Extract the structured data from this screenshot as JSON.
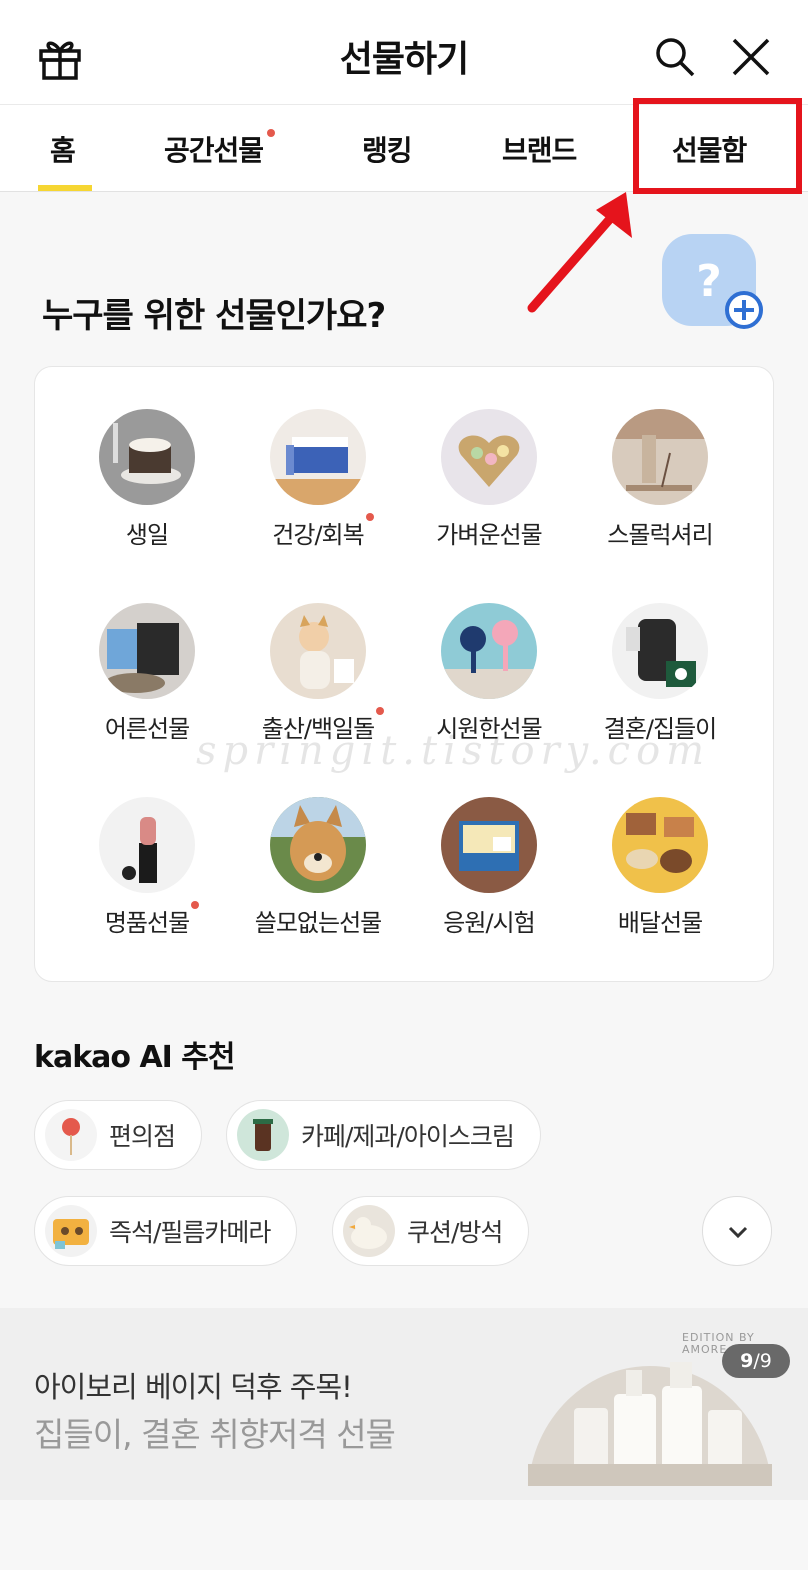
{
  "header": {
    "title": "선물하기"
  },
  "tabs": [
    {
      "label": "홈"
    },
    {
      "label": "공간선물"
    },
    {
      "label": "랭킹"
    },
    {
      "label": "브랜드"
    },
    {
      "label": "선물함"
    }
  ],
  "question": "누구를 위한 선물인가요?",
  "categories": [
    {
      "label": "생일"
    },
    {
      "label": "건강/회복"
    },
    {
      "label": "가벼운선물"
    },
    {
      "label": "스몰럭셔리"
    },
    {
      "label": "어른선물"
    },
    {
      "label": "출산/백일돌"
    },
    {
      "label": "시원한선물"
    },
    {
      "label": "결혼/집들이"
    },
    {
      "label": "명품선물"
    },
    {
      "label": "쓸모없는선물"
    },
    {
      "label": "응원/시험"
    },
    {
      "label": "배달선물"
    }
  ],
  "ai": {
    "brand": "kakao AI",
    "suffix": "추천"
  },
  "chips": [
    {
      "label": "편의점"
    },
    {
      "label": "카페/제과/아이스크림"
    },
    {
      "label": "즉석/필름카메라"
    },
    {
      "label": "쿠션/방석"
    }
  ],
  "banner": {
    "line1": "아이보리 베이지 덕후 주목!",
    "line2": "집들이, 결혼 취향저격 선물",
    "edition": "EDITION BY AMORE",
    "page_current": "9",
    "page_total": "/9"
  },
  "watermark": "springit.tistory.com",
  "colors": {
    "accent": "#f6d632",
    "dot": "#e4594c",
    "highlight": "#e5141c"
  }
}
